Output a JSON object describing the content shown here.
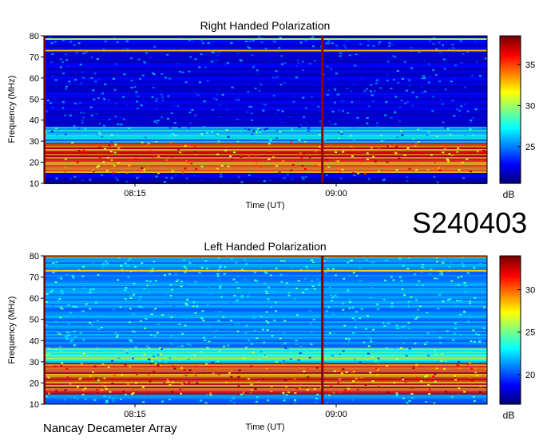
{
  "observation_id": "S240403",
  "observatory": "Nancay Decameter Array",
  "chart_data": [
    {
      "type": "heatmap",
      "title": "Right Handed Polarization",
      "xlabel": "Time (UT)",
      "ylabel": "Frequency (MHz)",
      "x_ticks": [
        "08:15",
        "09:00"
      ],
      "y_ticks": [
        10,
        20,
        30,
        40,
        50,
        60,
        70,
        80
      ],
      "ylim": [
        10,
        80
      ],
      "colorbar": {
        "label": "dB",
        "ticks": [
          25,
          30,
          35
        ],
        "range": [
          20.5,
          38.5
        ]
      },
      "colormap": "jet",
      "background_level_db": 22,
      "features": [
        {
          "kind": "band",
          "freq_low_mhz": 15,
          "freq_high_mhz": 30,
          "level_db": 35
        },
        {
          "kind": "band",
          "freq_low_mhz": 30,
          "freq_high_mhz": 37,
          "level_db": 27
        },
        {
          "kind": "line",
          "freq_mhz": 73,
          "level_db": 33
        },
        {
          "kind": "line",
          "freq_mhz": 78.5,
          "level_db": 30
        },
        {
          "kind": "vertical_burst",
          "time_ut": "08:57",
          "level_db": 38
        }
      ]
    },
    {
      "type": "heatmap",
      "title": "Left Handed Polarization",
      "xlabel": "Time (UT)",
      "ylabel": "Frequency (MHz)",
      "x_ticks": [
        "08:15",
        "09:00"
      ],
      "y_ticks": [
        10,
        20,
        30,
        40,
        50,
        60,
        70,
        80
      ],
      "ylim": [
        10,
        80
      ],
      "colorbar": {
        "label": "dB",
        "ticks": [
          20,
          25,
          30
        ],
        "range": [
          16.5,
          34
        ]
      },
      "colormap": "jet",
      "background_level_db": 21,
      "features": [
        {
          "kind": "band",
          "freq_low_mhz": 15,
          "freq_high_mhz": 30,
          "level_db": 31
        },
        {
          "kind": "band",
          "freq_low_mhz": 30,
          "freq_high_mhz": 37,
          "level_db": 24
        },
        {
          "kind": "line",
          "freq_mhz": 73,
          "level_db": 28
        },
        {
          "kind": "line",
          "freq_mhz": 79.5,
          "level_db": 30
        },
        {
          "kind": "vertical_burst",
          "time_ut": "08:57",
          "level_db": 34
        }
      ]
    }
  ]
}
